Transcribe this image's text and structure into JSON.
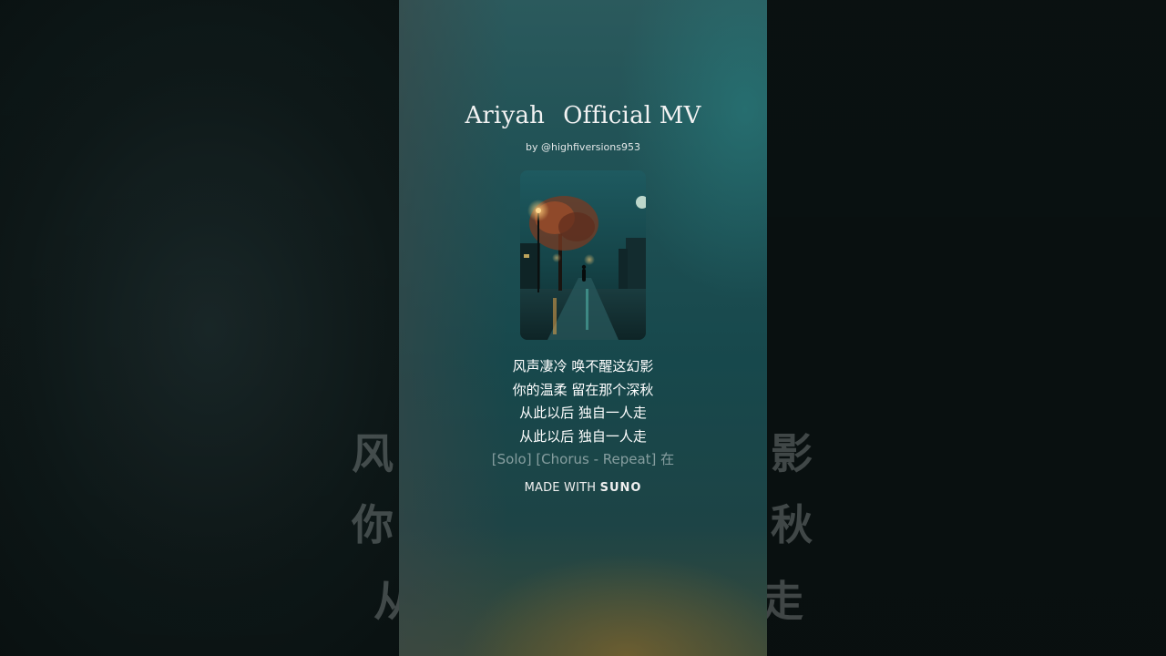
{
  "video": {
    "title_part1": "Ariyah",
    "title_part2": "Official MV",
    "byline": "by @highfiversions953",
    "cover_alt": "Night street with lamp post, tree, wet pavement and moon",
    "lyrics": [
      "风声凄冷 唤不醒这幻影",
      "你的温柔 留在那个深秋",
      "从此以后 独自一人走",
      "从此以后 独自一人走",
      "[Solo] [Chorus - Repeat] 在"
    ],
    "made_with_label": "MADE WITH",
    "made_with_brand": "SUNO"
  },
  "backdrop": {
    "ghost": {
      "left_1": "风",
      "left_2": "你",
      "left_3": "从",
      "right_1": "影",
      "right_2": "秋",
      "right_3": "走"
    }
  },
  "colors": {
    "panel_top": "#2b5a5d",
    "panel_mid": "#17484c",
    "backdrop": "#0b1414",
    "text": "#ffffff"
  }
}
